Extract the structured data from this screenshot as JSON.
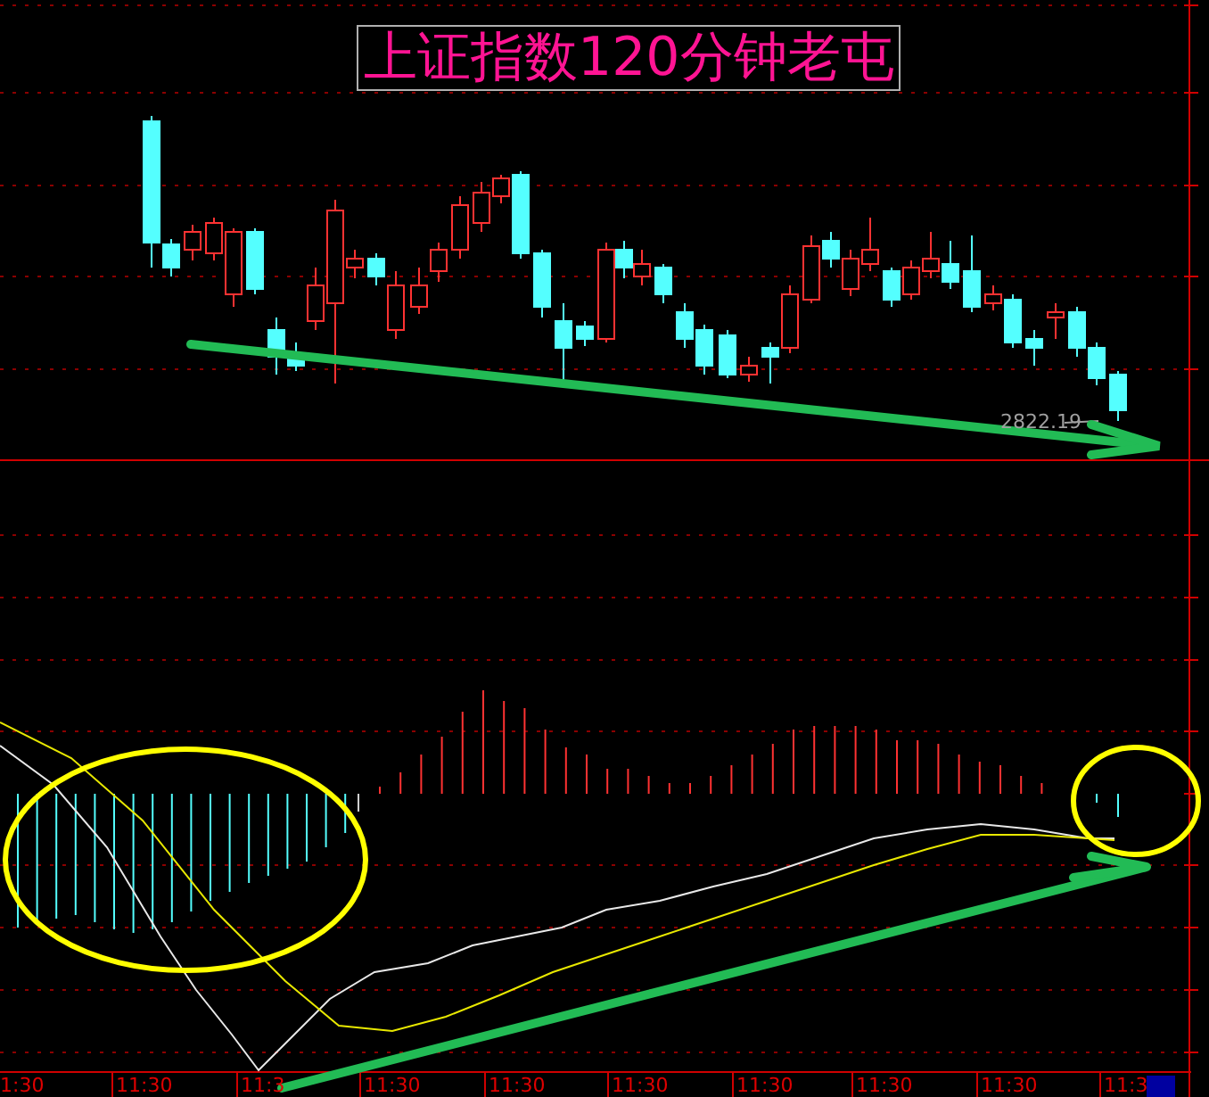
{
  "title": "上证指数120分钟老屯",
  "price_label": "2822.19",
  "time_axis": [
    "1:30",
    "11:30",
    "11:3",
    "11:30",
    "11:30",
    "11:30",
    "11:30",
    "11:30",
    "11:30",
    "11:3"
  ]
}
